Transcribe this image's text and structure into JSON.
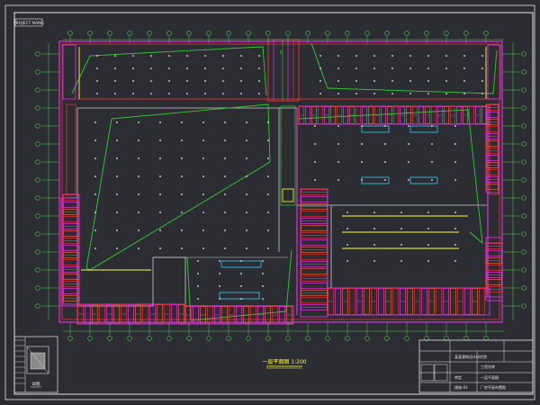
{
  "drawing": {
    "sheet_label": "PROJECT NAME",
    "plan_title": "一层平面图 1:200",
    "detail_title": "详图",
    "colors": {
      "background": "#2b2d33",
      "frame": "#e6e6e6",
      "grid_axis": "#4cc94c",
      "wall": "#ff3333",
      "room": "#ff33ff",
      "boundary": "#33cc33",
      "highlight": "#ffff33",
      "fixture": "#33bbdd",
      "dots": "#dddddd",
      "brick": "#ff6a3a"
    }
  },
  "title_block": {
    "rows": [
      [
        "某某建筑设计研究院",
        "工程名称"
      ],
      [
        "审定",
        "一层平面图"
      ],
      [
        "建施-03",
        "厂房平面布置图"
      ]
    ]
  }
}
